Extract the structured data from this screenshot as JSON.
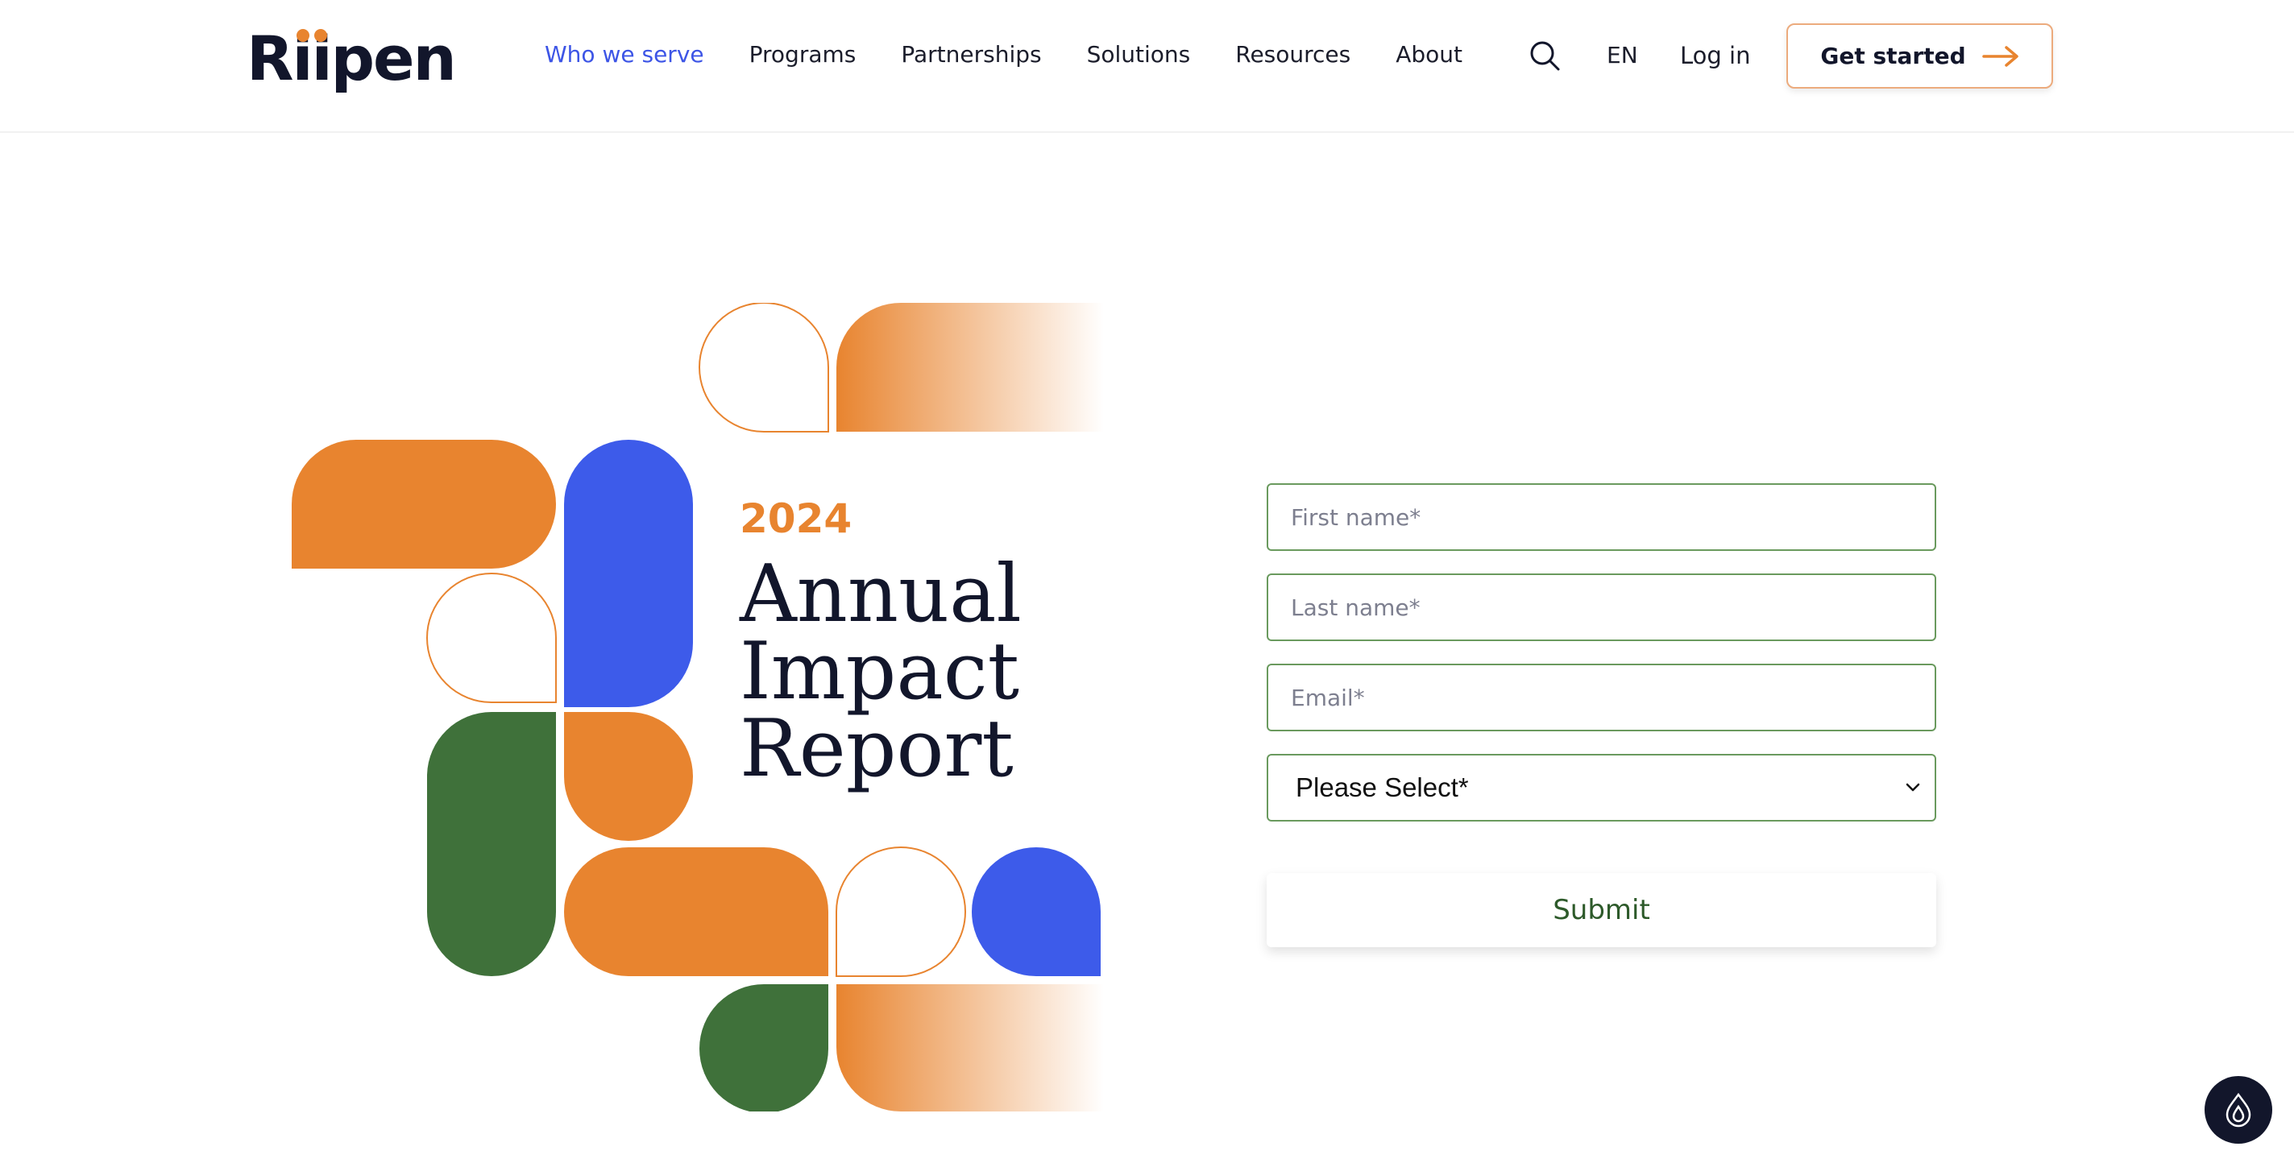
{
  "brand": {
    "logo_text_r": "R",
    "logo_text_ii": "ii",
    "logo_text_pen": "pen",
    "accent": "#e8842f",
    "blue": "#3d55e6",
    "green": "#3f713a",
    "dark": "#12162b"
  },
  "nav": {
    "items": [
      {
        "label": "Who we serve",
        "active": true
      },
      {
        "label": "Programs"
      },
      {
        "label": "Partnerships"
      },
      {
        "label": "Solutions"
      },
      {
        "label": "Resources"
      },
      {
        "label": "About"
      }
    ],
    "search_icon": "search-icon",
    "language": "EN",
    "login": "Log in",
    "cta": "Get started",
    "cta_icon": "arrow-right-icon"
  },
  "hero": {
    "year": "2024",
    "title_lines": [
      "Annual",
      "Impact",
      "Report"
    ]
  },
  "form": {
    "first_name_placeholder": "First name*",
    "last_name_placeholder": "Last name*",
    "email_placeholder": "Email*",
    "select_value": "Please Select*",
    "submit": "Submit"
  },
  "chat": {
    "icon": "chat-widget-icon"
  }
}
